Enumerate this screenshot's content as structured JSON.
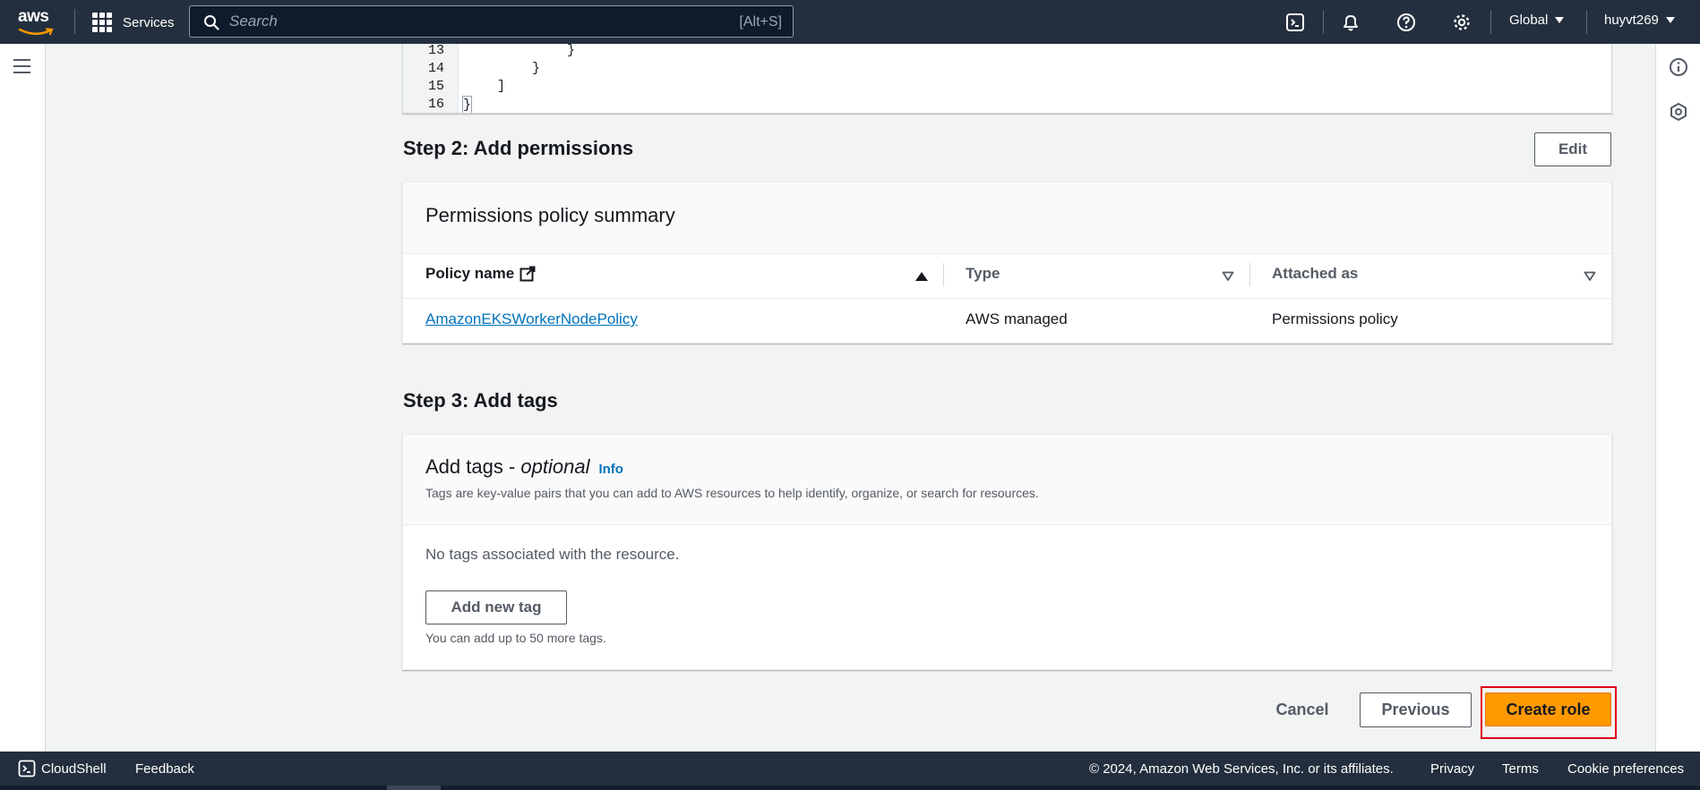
{
  "topnav": {
    "logo_text": "aws",
    "services_label": "Services",
    "search_placeholder": "Search",
    "search_shortcut": "[Alt+S]",
    "region_label": "Global",
    "account_label": "huyvt269"
  },
  "code": {
    "lines": [
      {
        "num": "13",
        "text": "}"
      },
      {
        "num": "14",
        "text": "}"
      },
      {
        "num": "15",
        "text": "]"
      },
      {
        "num": "16",
        "text": "}"
      }
    ]
  },
  "step2": {
    "title": "Step 2: Add permissions",
    "edit_label": "Edit",
    "card_title": "Permissions policy summary",
    "columns": [
      "Policy name",
      "Type",
      "Attached as"
    ],
    "rows": [
      {
        "policy_name": "AmazonEKSWorkerNodePolicy",
        "type": "AWS managed",
        "attached_as": "Permissions policy"
      }
    ]
  },
  "step3": {
    "title": "Step 3: Add tags",
    "card_title_main": "Add tags - ",
    "card_title_italic": "optional",
    "info_label": "Info",
    "description": "Tags are key-value pairs that you can add to AWS resources to help identify, organize, or search for resources.",
    "empty_text": "No tags associated with the resource.",
    "add_tag_label": "Add new tag",
    "limit_text": "You can add up to 50 more tags."
  },
  "actions": {
    "cancel_label": "Cancel",
    "previous_label": "Previous",
    "create_label": "Create role"
  },
  "bottombar": {
    "cloudshell_label": "CloudShell",
    "feedback_label": "Feedback",
    "copyright": "© 2024, Amazon Web Services, Inc. or its affiliates.",
    "privacy_label": "Privacy",
    "terms_label": "Terms",
    "cookie_label": "Cookie preferences"
  },
  "colors": {
    "nav_bg": "#232f3e",
    "primary": "#ff9900",
    "link": "#0073bb",
    "focus_ring": "#e0001b"
  }
}
